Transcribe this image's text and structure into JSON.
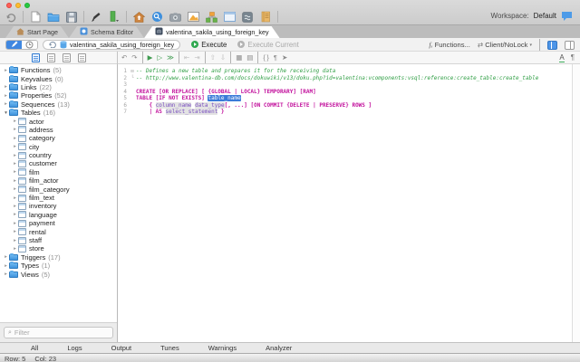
{
  "window": {
    "workspace_label": "Workspace:",
    "workspace_value": "Default"
  },
  "main_toolbar": {
    "icons": [
      "undo",
      "divider",
      "new-document",
      "open-folder",
      "save",
      "divider",
      "pen",
      "color-swatch",
      "divider",
      "home",
      "find",
      "snapshot",
      "image",
      "objects",
      "window",
      "script",
      "report",
      "divider"
    ],
    "chat_icon": "chat"
  },
  "document_tabs": [
    {
      "label": "Start Page",
      "icon": "home-tab",
      "active": false
    },
    {
      "label": "Schema Editor",
      "icon": "schema-tab",
      "active": false
    },
    {
      "label": "valentina_sakila_using_foreign_key",
      "icon": "db-tab",
      "active": true
    }
  ],
  "toolbar2": {
    "segmented_icons": [
      "pencil",
      "clock"
    ],
    "document_field": {
      "icons": [
        "history-arrow",
        "database"
      ],
      "value": "valentina_sakila_using_foreign_key"
    },
    "execute_label": "Execute",
    "execute_current_label": "Execute Current",
    "functions_label": "Functions...",
    "lock_mode_label": "Client/NoLock"
  },
  "editor_toolbar": {
    "icons": [
      "undo",
      "redo",
      "divider",
      "run-selection",
      "run-step",
      "run-all",
      "divider",
      "shift-left",
      "shift-right",
      "divider",
      "move-up",
      "move-down",
      "divider",
      "view-grid",
      "view-text",
      "divider",
      "brackets",
      "comment",
      "jump"
    ],
    "right_icons": [
      "text-encoding",
      "show-invisibles"
    ]
  },
  "sidebar_header": {
    "icons": [
      "tree-view",
      "column-view",
      "list-view",
      "card-view"
    ],
    "active_index": 0
  },
  "sidebar": {
    "filter_placeholder": "Filter",
    "tree": [
      {
        "label": "Functions",
        "count": "(5)",
        "icon": "folder",
        "chevron": "right",
        "level": 0
      },
      {
        "label": "Keyvalues",
        "count": "(0)",
        "icon": "folder",
        "chevron": "none",
        "level": 0
      },
      {
        "label": "Links",
        "count": "(22)",
        "icon": "folder",
        "chevron": "right",
        "level": 0
      },
      {
        "label": "Properties",
        "count": "(52)",
        "icon": "folder",
        "chevron": "right",
        "level": 0
      },
      {
        "label": "Sequences",
        "count": "(13)",
        "icon": "folder",
        "chevron": "right",
        "level": 0
      },
      {
        "label": "Tables",
        "count": "(16)",
        "icon": "folder",
        "chevron": "down",
        "level": 0
      },
      {
        "label": "actor",
        "count": "",
        "icon": "table",
        "chevron": "right",
        "level": 1
      },
      {
        "label": "address",
        "count": "",
        "icon": "table",
        "chevron": "right",
        "level": 1
      },
      {
        "label": "category",
        "count": "",
        "icon": "table",
        "chevron": "right",
        "level": 1
      },
      {
        "label": "city",
        "count": "",
        "icon": "table",
        "chevron": "right",
        "level": 1
      },
      {
        "label": "country",
        "count": "",
        "icon": "table",
        "chevron": "right",
        "level": 1
      },
      {
        "label": "customer",
        "count": "",
        "icon": "table",
        "chevron": "right",
        "level": 1
      },
      {
        "label": "film",
        "count": "",
        "icon": "table",
        "chevron": "right",
        "level": 1
      },
      {
        "label": "film_actor",
        "count": "",
        "icon": "table",
        "chevron": "right",
        "level": 1
      },
      {
        "label": "film_category",
        "count": "",
        "icon": "table",
        "chevron": "right",
        "level": 1
      },
      {
        "label": "film_text",
        "count": "",
        "icon": "table",
        "chevron": "right",
        "level": 1
      },
      {
        "label": "inventory",
        "count": "",
        "icon": "table",
        "chevron": "right",
        "level": 1
      },
      {
        "label": "language",
        "count": "",
        "icon": "table",
        "chevron": "right",
        "level": 1
      },
      {
        "label": "payment",
        "count": "",
        "icon": "table",
        "chevron": "right",
        "level": 1
      },
      {
        "label": "rental",
        "count": "",
        "icon": "table",
        "chevron": "right",
        "level": 1
      },
      {
        "label": "staff",
        "count": "",
        "icon": "table",
        "chevron": "right",
        "level": 1
      },
      {
        "label": "store",
        "count": "",
        "icon": "table",
        "chevron": "right",
        "level": 1
      },
      {
        "label": "Triggers",
        "count": "(17)",
        "icon": "folder",
        "chevron": "right",
        "level": 0
      },
      {
        "label": "Types",
        "count": "(1)",
        "icon": "folder",
        "chevron": "right",
        "level": 0
      },
      {
        "label": "Views",
        "count": "(5)",
        "icon": "folder",
        "chevron": "right",
        "level": 0
      }
    ]
  },
  "editor": {
    "lines": [
      {
        "n": "1",
        "fold": "box",
        "tokens": [
          {
            "c": "comment",
            "t": "-- Defines a new table and prepares it for the receiving data"
          }
        ]
      },
      {
        "n": "2",
        "fold": "end",
        "tokens": [
          {
            "c": "comment",
            "t": "-- http://www.valentina-db.com/docs/dokuwiki/v13/doku.php?id=valentina:vcomponents:vsql:reference:create_table:create_table"
          }
        ]
      },
      {
        "n": "3",
        "fold": "",
        "tokens": []
      },
      {
        "n": "4",
        "fold": "",
        "tokens": [
          {
            "c": "kw",
            "t": "CREATE [OR REPLACE] [ {GLOBAL | LOCAL} TEMPORARY] [RAM]"
          }
        ]
      },
      {
        "n": "5",
        "fold": "",
        "tokens": [
          {
            "c": "kw",
            "t": "TABLE [IF NOT EXISTS] "
          },
          {
            "c": "sel",
            "t": "table_name"
          }
        ]
      },
      {
        "n": "6",
        "fold": "",
        "tokens": [
          {
            "c": "kw",
            "t": "    { "
          },
          {
            "c": "ph",
            "t": "column_name"
          },
          {
            "c": "kw",
            "t": " "
          },
          {
            "c": "ph",
            "t": "data_type"
          },
          {
            "c": "kw",
            "t": "[, ...] [ON COMMIT {DELETE | PRESERVE} ROWS ]"
          }
        ]
      },
      {
        "n": "7",
        "fold": "",
        "tokens": [
          {
            "c": "kw",
            "t": "    | AS "
          },
          {
            "c": "ph",
            "t": "select_statement"
          },
          {
            "c": "kw",
            "t": " }"
          }
        ]
      }
    ]
  },
  "bottom_tabs": [
    "All",
    "Logs",
    "Output",
    "Tunes",
    "Warnings",
    "Analyzer"
  ],
  "status_bar": {
    "row_label": "Row: 5",
    "col_label": "Col: 23"
  }
}
